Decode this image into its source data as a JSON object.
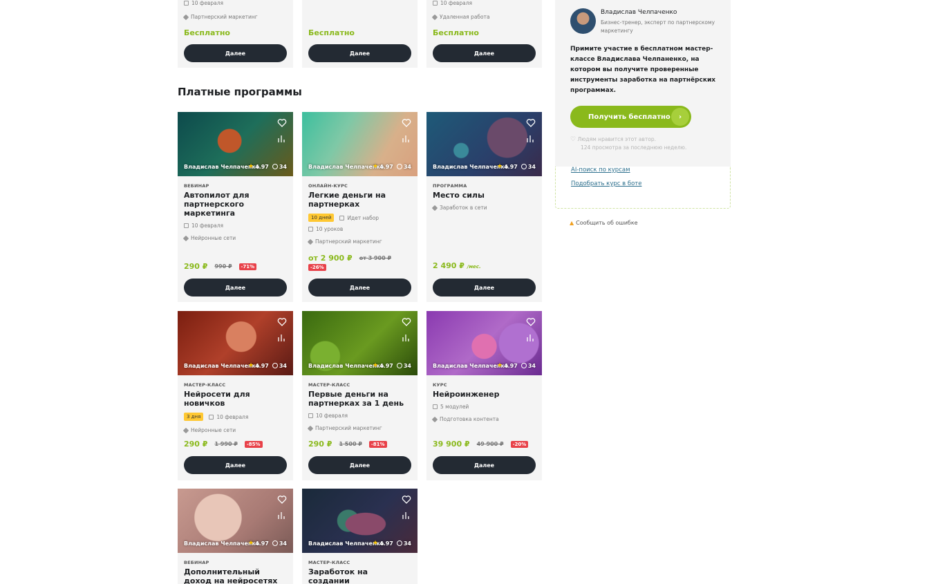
{
  "top_cards": [
    {
      "date": "10 февраля",
      "tag": "Партнерский маркетинг",
      "price": "Бесплатно",
      "button": "Далее"
    },
    {
      "date": "",
      "tag": "",
      "price": "Бесплатно",
      "button": "Далее"
    },
    {
      "date": "10 февраля",
      "tag": "Удаленная работа",
      "price": "Бесплатно",
      "button": "Далее"
    }
  ],
  "section_title": "Платные программы",
  "cards": [
    {
      "author": "Владислав Челпаченко",
      "rating": "4.97",
      "views": "34",
      "type": "ВЕБИНАР",
      "title": "Автопилот для партнерского маркетинга",
      "badge": "",
      "date": "10 февраля",
      "extra": "",
      "tag": "Нейронные сети",
      "price": "290 ₽",
      "price_suffix": "",
      "old_price": "990 ₽",
      "discount": "-71%",
      "button": "Далее"
    },
    {
      "author": "Владислав Челпаченко",
      "rating": "4.97",
      "views": "34",
      "type": "ОНЛАЙН-КУРС",
      "title": "Легкие деньги на партнерках",
      "badge": "10 дней",
      "date": "Идет набор",
      "extra": "10 уроков",
      "tag": "Партнерский маркетинг",
      "price": "от 2 900 ₽",
      "price_suffix": "",
      "old_price": "от 3 900 ₽",
      "discount": "-26%",
      "button": "Далее"
    },
    {
      "author": "Владислав Челпаченко",
      "rating": "4.97",
      "views": "34",
      "type": "ПРОГРАММА",
      "title": "Место силы",
      "badge": "",
      "date": "",
      "extra": "",
      "tag": "Заработок в сети",
      "price": "2 490 ₽",
      "price_suffix": "/мес.",
      "old_price": "",
      "discount": "",
      "button": "Далее"
    },
    {
      "author": "Владислав Челпаченко",
      "rating": "4.97",
      "views": "34",
      "type": "МАСТЕР-КЛАСС",
      "title": "Нейросети для новичков",
      "badge": "3 дня",
      "date": "10 февраля",
      "extra": "",
      "tag": "Нейронные сети",
      "price": "290 ₽",
      "price_suffix": "",
      "old_price": "1 990 ₽",
      "discount": "-85%",
      "button": "Далее"
    },
    {
      "author": "Владислав Челпаченко",
      "rating": "4.97",
      "views": "34",
      "type": "МАСТЕР-КЛАСС",
      "title": "Первые деньги на партнерках за 1 день",
      "badge": "",
      "date": "10 февраля",
      "extra": "",
      "tag": "Партнерский маркетинг",
      "price": "290 ₽",
      "price_suffix": "",
      "old_price": "1 500 ₽",
      "discount": "-81%",
      "button": "Далее"
    },
    {
      "author": "Владислав Челпаченко",
      "rating": "4.97",
      "views": "34",
      "type": "КУРС",
      "title": "Нейроинженер",
      "badge": "",
      "date": "5 модулей",
      "extra": "",
      "tag": "Подготовка контента",
      "price": "39 900 ₽",
      "price_suffix": "",
      "old_price": "49 900 ₽",
      "discount": "-20%",
      "button": "Далее"
    },
    {
      "author": "Владислав Челпаченко",
      "rating": "4.97",
      "views": "34",
      "type": "ВЕБИНАР",
      "title": "Дополнительный доход на нейросетях",
      "badge": "",
      "date": "",
      "extra": "",
      "tag": "",
      "price": "",
      "price_suffix": "",
      "old_price": "",
      "discount": "",
      "button": ""
    },
    {
      "author": "Владислав Челпаченко",
      "rating": "4.97",
      "views": "34",
      "type": "МАСТЕР-КЛАСС",
      "title": "Заработок на создании нейрокартинок",
      "badge": "",
      "date": "",
      "extra": "",
      "tag": "",
      "price": "",
      "price_suffix": "",
      "old_price": "",
      "discount": "",
      "button": ""
    }
  ],
  "sidebar": {
    "name": "Владислав Челпаченко",
    "role": "Бизнес-тренер, эксперт по партнерскому маркетингу",
    "description": "Примите участие в бесплатном мастер-классе Владислава Челпаненко, на котором вы получите проверенные инструменты заработка на партнёрских программах.",
    "cta": "Получить бесплатно",
    "likes_line1": "Людям нравится этот автор.",
    "likes_line2": "124 просмотра за последнюю неделю.",
    "link_ai": "AI-поиск по курсам",
    "link_bot": "Подобрать курс в боте",
    "report": "Сообщить об ошибке"
  },
  "colors": {
    "accent": "#8ab91c",
    "button": "#232a33",
    "discount": "#e84149",
    "badge": "#ffc832"
  }
}
